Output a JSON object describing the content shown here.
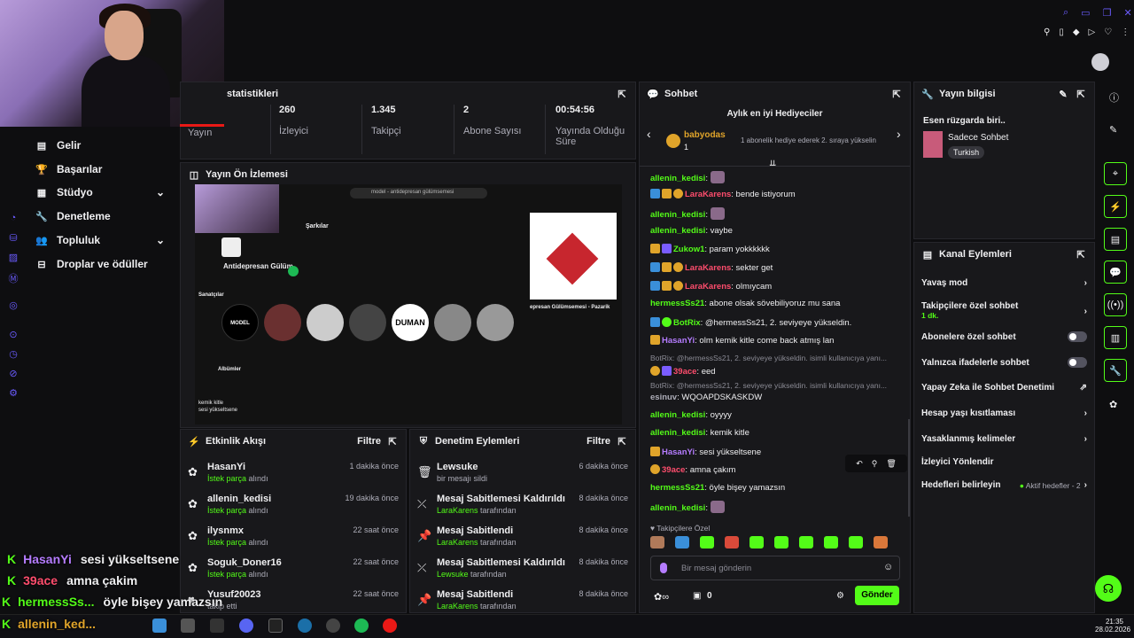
{
  "window_icons": [
    "search-icon",
    "minimize-icon",
    "maximize-icon",
    "close-icon"
  ],
  "nav": {
    "items": [
      {
        "label": "Gelir",
        "icon": "wallet-icon"
      },
      {
        "label": "Başarılar",
        "icon": "trophy-icon"
      },
      {
        "label": "Stüdyo",
        "icon": "studio-icon"
      },
      {
        "label": "Denetleme",
        "icon": "wrench-icon"
      },
      {
        "label": "Topluluk",
        "icon": "community-icon"
      },
      {
        "label": "Droplar ve ödüller",
        "icon": "gift-icon"
      }
    ]
  },
  "stats": {
    "title": "statistikleri",
    "items": [
      {
        "value": "",
        "label": "Yayın"
      },
      {
        "value": "260",
        "label": "İzleyici"
      },
      {
        "value": "1.345",
        "label": "Takipçi"
      },
      {
        "value": "2",
        "label": "Abone Sayısı"
      },
      {
        "value": "00:54:56",
        "label": "Yayında Olduğu Süre"
      }
    ]
  },
  "preview": {
    "title": "Yayın Ön İzlemesi",
    "inner_search": "model - antidepresan gülümsemesi",
    "inner_title": "Antidepresan Gülüm",
    "inner_section1": "Şarkılar",
    "inner_section2": "Sanatçılar",
    "inner_section3": "Albümler",
    "inner_artist": "DUMAN",
    "inner_album": "MODEL",
    "inner_now": "epresan Gülümsemesi - Pazarik",
    "inner_chat1": "kemik kitle",
    "inner_chat2": "sesi yükseltsene"
  },
  "events": {
    "title": "Etkinlik Akışı",
    "filter": "Filtre",
    "rows": [
      {
        "name": "HasanYi",
        "tag": "İstek parça",
        "sub": "alındı",
        "time": "1 dakika önce"
      },
      {
        "name": "allenin_kedisi",
        "tag": "İstek parça",
        "sub": "alındı",
        "time": "19 dakika önce"
      },
      {
        "name": "ilysnmx",
        "tag": "İstek parça",
        "sub": "alındı",
        "time": "22 saat önce"
      },
      {
        "name": "Soguk_Doner16",
        "tag": "İstek parça",
        "sub": "alındı",
        "time": "22 saat önce"
      },
      {
        "name": "Yusuf20023",
        "tag": "",
        "sub": "takip etti",
        "time": "22 saat önce"
      }
    ]
  },
  "modlog": {
    "title": "Denetim Eylemleri",
    "filter": "Filtre",
    "rows": [
      {
        "name": "Lewsuke",
        "tag": "",
        "sub": "bir mesajı sildi",
        "time": "6 dakika önce"
      },
      {
        "name": "Mesaj Sabitlemesi Kaldırıldı",
        "tag": "LaraKarens",
        "sub": "tarafından",
        "time": "8 dakika önce"
      },
      {
        "name": "Mesaj Sabitlendi",
        "tag": "LaraKarens",
        "sub": "tarafından",
        "time": "8 dakika önce"
      },
      {
        "name": "Mesaj Sabitlemesi Kaldırıldı",
        "tag": "Lewsuke",
        "sub": "tarafından",
        "time": "8 dakika önce"
      },
      {
        "name": "Mesaj Sabitlendi",
        "tag": "LaraKarens",
        "sub": "tarafından",
        "time": "8 dakika önce"
      }
    ]
  },
  "chat": {
    "title": "Sohbet",
    "gifters_title": "Aylık en iyi Hediyeciler",
    "gifter_name": "babyodas",
    "gifter_count": "1",
    "gifter_hint": "1 abonelik hediye ederek 2. sıraya yükselin",
    "lines": [
      {
        "user": "allenin_kedisi",
        "color": "green",
        "text": ":",
        "emote": true,
        "badges": []
      },
      {
        "user": "LaraKarens",
        "color": "red",
        "text": ": bende istiyorum",
        "emote": false,
        "badges": [
          "blue",
          "gold",
          "round"
        ]
      },
      {
        "user": "allenin_kedisi",
        "color": "green",
        "text": ":",
        "emote": true,
        "badges": []
      },
      {
        "user": "allenin_kedisi",
        "color": "green",
        "text": ": vaybe",
        "emote": false,
        "badges": []
      },
      {
        "user": "Zukow1",
        "color": "green",
        "text": ": param yokkkkkk",
        "emote": false,
        "badges": [
          "gold",
          "purple"
        ]
      },
      {
        "user": "LaraKarens",
        "color": "red",
        "text": ": sekter get",
        "emote": false,
        "badges": [
          "blue",
          "gold",
          "round"
        ]
      },
      {
        "user": "LaraKarens",
        "color": "red",
        "text": ": olmıycam",
        "emote": false,
        "badges": [
          "blue",
          "gold",
          "round"
        ]
      },
      {
        "user": "hermessSs21",
        "color": "green",
        "text": ": abone olsak sövebiliyoruz mu sana",
        "emote": false,
        "badges": []
      },
      {
        "user": "BotRix",
        "color": "green",
        "text": ": @hermessSs21, 2. seviyeye yükseldin.",
        "emote": false,
        "badges": [
          "blue",
          "green"
        ]
      },
      {
        "user": "HasanYi",
        "color": "purple",
        "text": ": olm kemik kitle come back atmış lan",
        "emote": false,
        "badges": [
          "gold"
        ]
      },
      {
        "user": "",
        "color": "sys",
        "text": "BotRix: @hermessSs21, 2. seviyeye yükseldin. isimli kullanıcıya yanı...",
        "emote": false,
        "badges": []
      },
      {
        "user": "39ace",
        "color": "red",
        "text": ": eed",
        "emote": false,
        "badges": [
          "round",
          "purple"
        ]
      },
      {
        "user": "",
        "color": "sys",
        "text": "BotRix: @hermessSs21, 2. seviyeye yükseldin. isimli kullanıcıya yanı...",
        "emote": false,
        "badges": []
      },
      {
        "user": "esinuv",
        "color": "gray",
        "text": ": WQOAPDSKASKDW",
        "emote": false,
        "badges": []
      },
      {
        "user": "allenin_kedisi",
        "color": "green",
        "text": ": oyyyy",
        "emote": false,
        "badges": []
      },
      {
        "user": "allenin_kedisi",
        "color": "green",
        "text": ": kemik kitle",
        "emote": false,
        "badges": []
      },
      {
        "user": "HasanYi",
        "color": "purple",
        "text": ": sesi yükseltsene",
        "emote": false,
        "badges": [
          "gold"
        ]
      },
      {
        "user": "39ace",
        "color": "red",
        "text": ": amna çakım",
        "emote": false,
        "badges": [
          "round"
        ]
      },
      {
        "user": "hermessSs21",
        "color": "green",
        "text": ": öyle bişey yamazsın",
        "emote": false,
        "badges": []
      },
      {
        "user": "allenin_kedisi",
        "color": "green",
        "text": ":",
        "emote": true,
        "badges": []
      }
    ],
    "emote_label": "Takipçilere Özel",
    "input_placeholder": "Bir mesaj gönderin",
    "points": "0",
    "send": "Gönder"
  },
  "streaminfo": {
    "title": "Yayın bilgisi",
    "stream_title": "Esen rüzgarda biri..",
    "category": "Sadece Sohbet",
    "language": "Turkish"
  },
  "actions": {
    "title": "Kanal Eylemleri",
    "items": [
      {
        "label": "Yavaş mod",
        "sub": "",
        "control": "chevron"
      },
      {
        "label": "Takipçilere özel sohbet",
        "sub": "1 dk.",
        "control": "chevron"
      },
      {
        "label": "Abonelere özel sohbet",
        "sub": "",
        "control": "toggle"
      },
      {
        "label": "Yalnızca ifadelerle sohbet",
        "sub": "",
        "control": "toggle"
      },
      {
        "label": "Yapay Zeka ile Sohbet Denetimi",
        "sub": "",
        "control": "external"
      },
      {
        "label": "Hesap yaşı kısıtlaması",
        "sub": "",
        "control": "chevron"
      },
      {
        "label": "Yasaklanmış kelimeler",
        "sub": "",
        "control": "chevron"
      },
      {
        "label": "İzleyici Yönlendir",
        "sub": "",
        "control": "none"
      },
      {
        "label": "Hedefleri belirleyin",
        "sub": "Aktif hedefler - 2",
        "control": "chevron"
      }
    ]
  },
  "overlay": {
    "lines": [
      {
        "user": "HasanYi",
        "text": "sesi yükseltsene",
        "color": "#b57cff"
      },
      {
        "user": "39ace",
        "text": "amna çakim",
        "color": "#ff4d6d"
      },
      {
        "user": "hermessSs...",
        "text": "öyle bişey yamazsın",
        "color": "#53fc18"
      },
      {
        "user": "allenin_ked...",
        "text": "",
        "color": "#e0a42a"
      }
    ]
  },
  "clock": {
    "time": "21:35",
    "date": "28.02.2026"
  },
  "colors": {
    "accent": "#53fc18",
    "panel": "#18181b",
    "bg": "#0e0e10"
  }
}
